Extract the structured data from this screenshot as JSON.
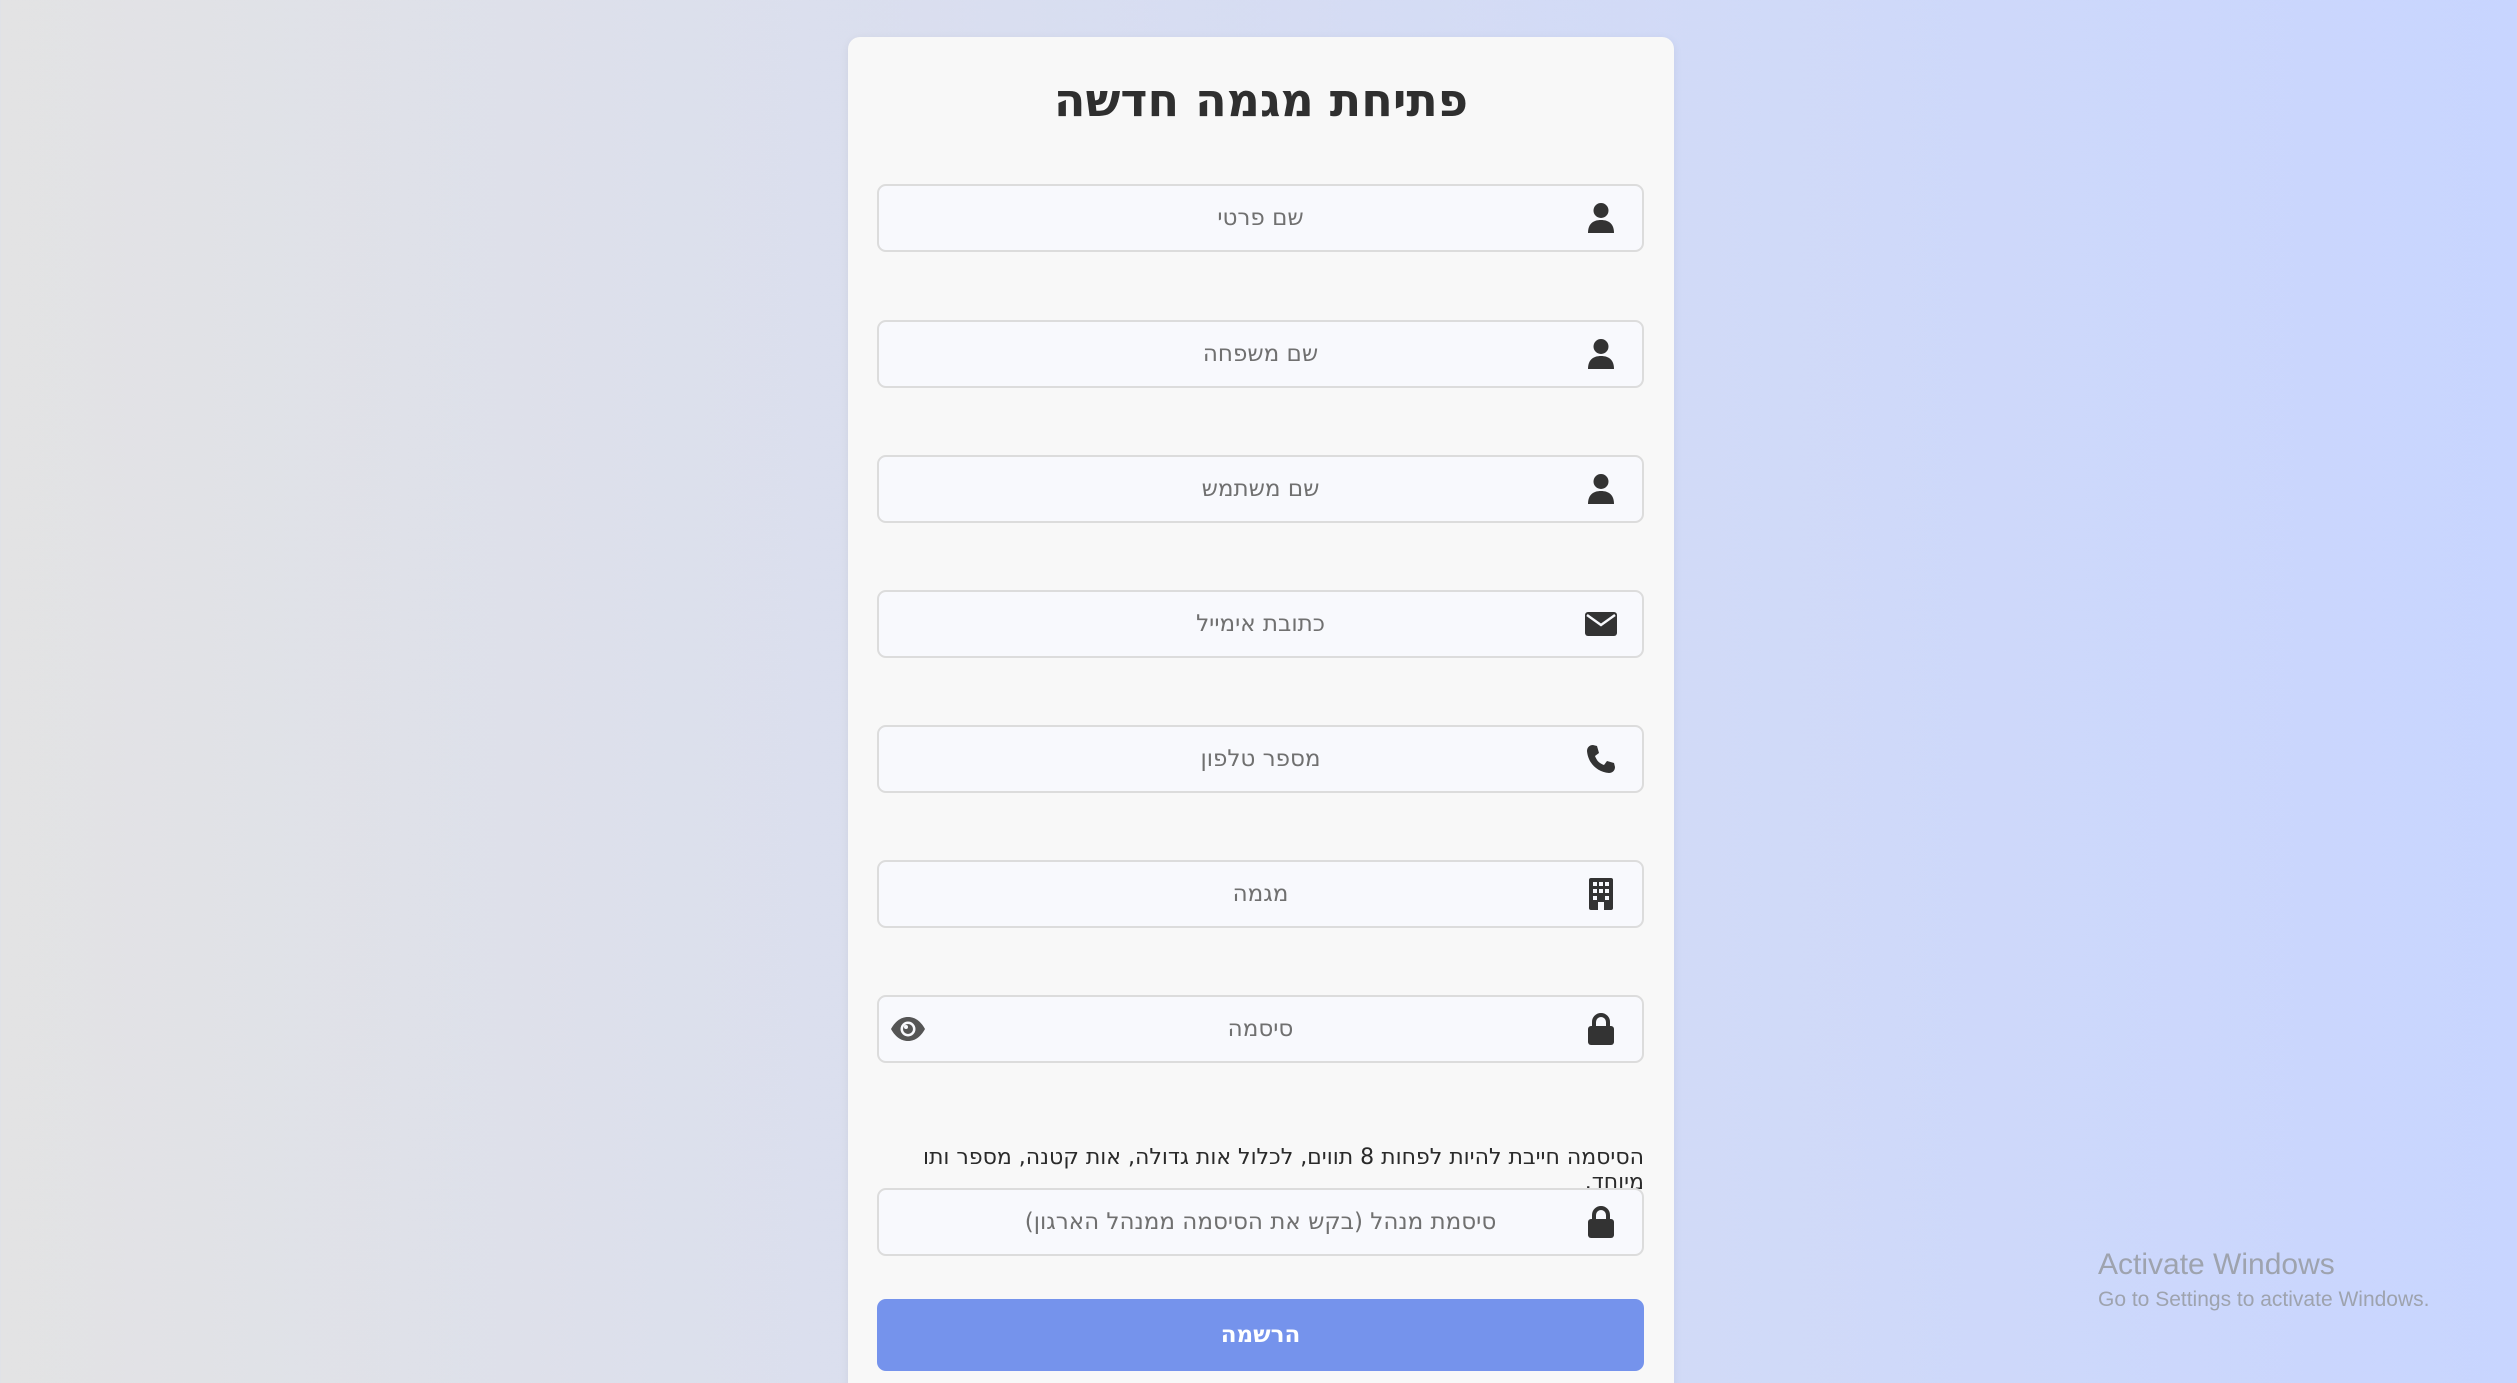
{
  "form": {
    "title": "פתיחת מגמה חדשה",
    "fields": [
      {
        "placeholder": "שם פרטי",
        "icon": "user-icon"
      },
      {
        "placeholder": "שם משפחה",
        "icon": "user-icon"
      },
      {
        "placeholder": "שם משתמש",
        "icon": "user-icon"
      },
      {
        "placeholder": "כתובת אימייל",
        "icon": "envelope-icon"
      },
      {
        "placeholder": "מספר טלפון",
        "icon": "phone-icon"
      },
      {
        "placeholder": "מגמה",
        "icon": "building-icon"
      },
      {
        "placeholder": "סיסמה",
        "icon": "lock-icon",
        "toggle_icon": "eye-icon"
      }
    ],
    "password_hint": "הסיסמה חייבת להיות לפחות 8 תווים, לכלול אות גדולה, אות קטנה, מספר ותו מיוחד.",
    "admin_password": {
      "placeholder": "סיסמת מנהל (בקש את הסיסמה ממנהל הארגון)",
      "icon": "lock-icon"
    },
    "submit_label": "הרשמה"
  },
  "watermark": {
    "line1": "Activate Windows",
    "line2": "Go to Settings to activate Windows."
  },
  "colors": {
    "button": "#7593ec",
    "icon": "#333333",
    "card": "#f8f8f8"
  }
}
